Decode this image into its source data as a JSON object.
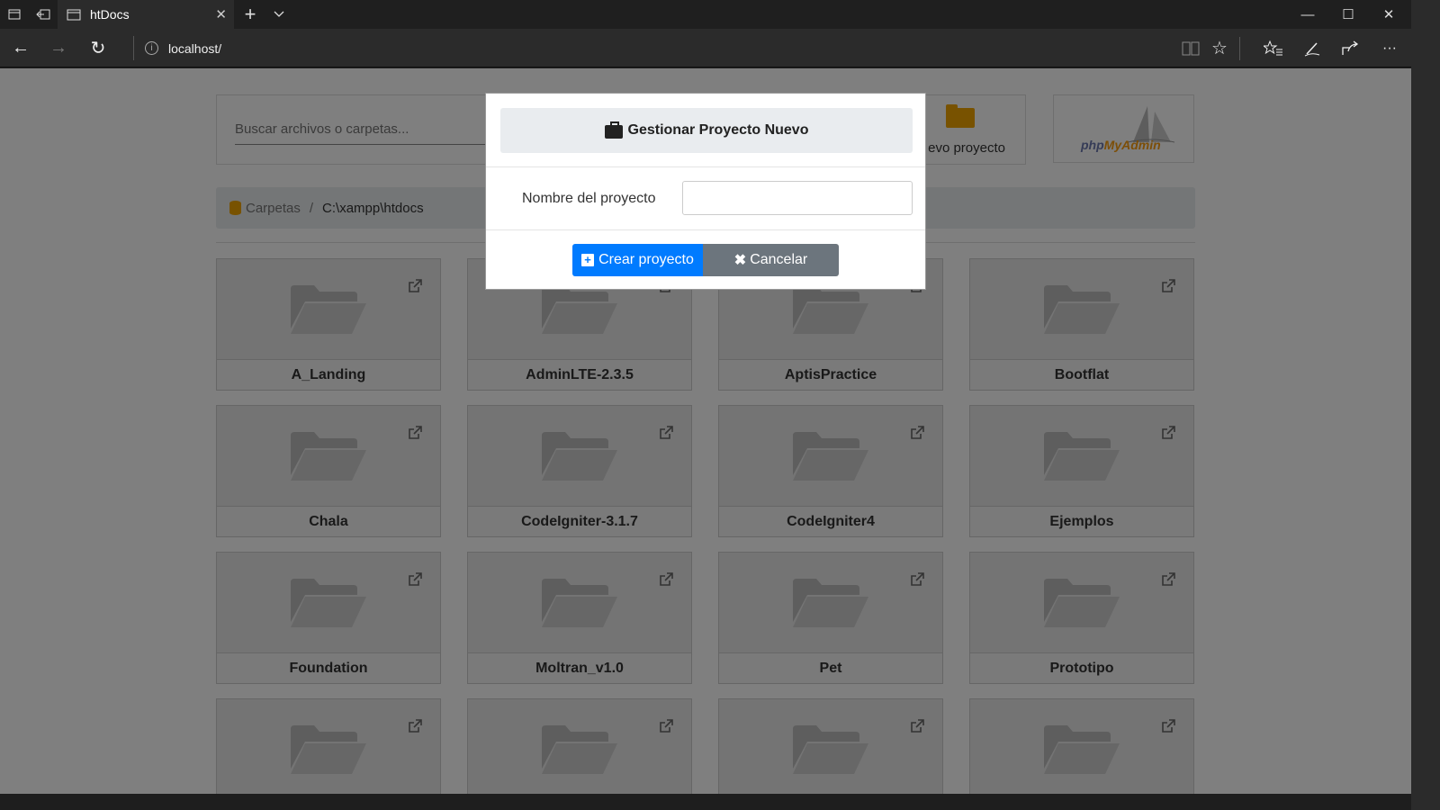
{
  "browser": {
    "tab_title": "htDocs",
    "url": "localhost/",
    "icons": {
      "tab_actions": "tabs-aside-icon",
      "tab_back": "set-aside-icon",
      "new_tab": "+",
      "tab_list": "chevron-down-icon",
      "back": "←",
      "forward": "→",
      "refresh": "↻",
      "reading_view": "book-icon",
      "favorite": "☆",
      "favorites_hub": "star-list-icon",
      "notes": "pen-icon",
      "share": "share-icon",
      "more": "···",
      "minimize": "—",
      "maximize": "☐",
      "close": "✕"
    }
  },
  "toolbar": {
    "search_placeholder": "Buscar archivos o carpetas...",
    "new_project_label": "evo proyecto",
    "phpmyadmin_logo_php": "php",
    "phpmyadmin_logo_rest": "MyAdmin"
  },
  "breadcrumb": {
    "root": "Carpetas",
    "separator": "/",
    "current": "C:\\xampp\\htdocs"
  },
  "folders": [
    {
      "name": "A_Landing"
    },
    {
      "name": "AdminLTE-2.3.5"
    },
    {
      "name": "AptisPractice"
    },
    {
      "name": "Bootflat"
    },
    {
      "name": "Chala"
    },
    {
      "name": "CodeIgniter-3.1.7"
    },
    {
      "name": "CodeIgniter4"
    },
    {
      "name": "Ejemplos"
    },
    {
      "name": "Foundation"
    },
    {
      "name": "Moltran_v1.0"
    },
    {
      "name": "Pet"
    },
    {
      "name": "Prototipo"
    },
    {
      "name": ""
    },
    {
      "name": ""
    },
    {
      "name": ""
    },
    {
      "name": ""
    }
  ],
  "modal": {
    "title": "Gestionar Proyecto Nuevo",
    "field_label": "Nombre del proyecto",
    "field_value": "",
    "create_label": "Crear proyecto",
    "cancel_label": "Cancelar"
  },
  "colors": {
    "primary": "#007bff",
    "secondary": "#6c757d",
    "folder_accent": "#f0a500"
  }
}
